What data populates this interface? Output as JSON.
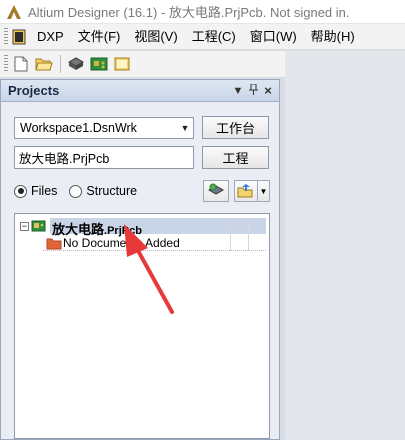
{
  "window": {
    "title": "Altium Designer (16.1) - 放大电路.PrjPcb. Not signed in."
  },
  "menu": {
    "items": [
      {
        "label": "DXP"
      },
      {
        "label": "文件(F)"
      },
      {
        "label": "视图(V)"
      },
      {
        "label": "工程(C)"
      },
      {
        "label": "窗口(W)"
      },
      {
        "label": "帮助(H)"
      }
    ]
  },
  "toolbar": {
    "icons": [
      "new-file-icon",
      "open-folder-icon",
      "chip-icon",
      "pcb-board-icon",
      "document-icon"
    ]
  },
  "panel": {
    "title": "Projects",
    "workspace_combo": "Workspace1.DsnWrk",
    "workspace_button": "工作台",
    "project_field": "放大电路.PrjPcb",
    "project_button": "工程",
    "radio_files": "Files",
    "radio_structure": "Structure",
    "selected_view": "Files"
  },
  "tree": {
    "project_name_main": "放大电路",
    "project_name_ext": ".PrjPcb",
    "expander": "−",
    "child_label": "No Documents Added"
  },
  "colors": {
    "selection": "#c9d4e6",
    "annotation_arrow": "#e8393a"
  }
}
